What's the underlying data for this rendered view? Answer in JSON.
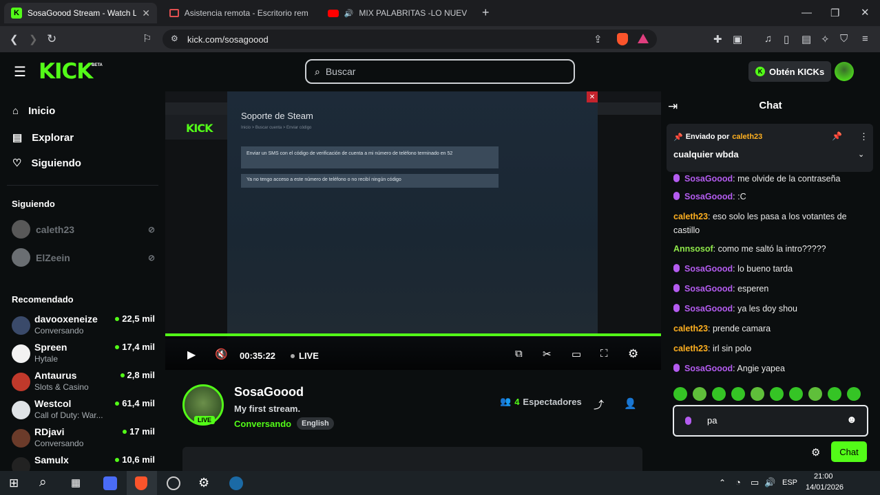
{
  "browser": {
    "tabs": [
      {
        "title": "SosaGoood Stream - Watch Live"
      },
      {
        "title": "Asistencia remota - Escritorio remoto"
      },
      {
        "title": "MIX PALABRITAS -LO NUEVO DE"
      }
    ],
    "new_tab": "+",
    "url": "kick.com/sosagoood",
    "shield_count": "5"
  },
  "header": {
    "logo": "KICK",
    "logo_beta": "BETA",
    "search_placeholder": "Buscar",
    "get_kicks": "Obtén KICKs"
  },
  "sidebar": {
    "nav": [
      {
        "label": "Inicio"
      },
      {
        "label": "Explorar"
      },
      {
        "label": "Siguiendo"
      }
    ],
    "following_title": "Siguiendo",
    "following": [
      {
        "name": "caleth23"
      },
      {
        "name": "ElZeein"
      }
    ],
    "recommended_title": "Recomendado",
    "recommended": [
      {
        "name": "davooxeneize",
        "category": "Conversando",
        "viewers": "22,5 mil"
      },
      {
        "name": "Spreen",
        "category": "Hytale",
        "viewers": "17,4 mil"
      },
      {
        "name": "Antaurus",
        "category": "Slots & Casino",
        "viewers": "2,8 mil"
      },
      {
        "name": "Westcol",
        "category": "Call of Duty: War...",
        "viewers": "61,4 mil"
      },
      {
        "name": "RDjavi",
        "category": "Conversando",
        "viewers": "17 mil"
      },
      {
        "name": "Samulx",
        "category": "",
        "viewers": "10,6 mil"
      }
    ]
  },
  "player": {
    "inner_dialog_title": "Soporte de Steam",
    "inner_breadcrumb": "Inicio > Buscar cuenta > Enviar código",
    "inner_option1": "Enviar un SMS con el código de verificación de cuenta a mi número de teléfono terminado en 52",
    "inner_option2": "Ya no tengo acceso a este número de teléfono o no recibí ningún código",
    "time": "00:35:22",
    "live": "LIVE",
    "progress": 1.0
  },
  "stream": {
    "channel": "SosaGoood",
    "live_badge": "LIVE",
    "title": "My first stream.",
    "category": "Conversando",
    "language": "English",
    "viewers_count": "4",
    "viewers_label": "Espectadores"
  },
  "chat": {
    "title": "Chat",
    "pinned_by_label": "Enviado por",
    "pinned_user": "caleth23",
    "pinned_message": "cualquier wbda",
    "messages": [
      {
        "user": "SosaGoood",
        "text": ": me olvide de la contraseña",
        "color": "#b45cf0",
        "mic": true
      },
      {
        "user": "SosaGoood",
        "text": ": :C",
        "color": "#b45cf0",
        "mic": true
      },
      {
        "user": "caleth23",
        "text": ": eso solo les pasa a los votantes de castillo",
        "color": "#ffb020",
        "mic": false
      },
      {
        "user": "Annsosof",
        "text": ": como me saltó la intro?????",
        "color": "#8fe84a",
        "mic": false
      },
      {
        "user": "SosaGoood",
        "text": ": lo bueno tarda",
        "color": "#b45cf0",
        "mic": true
      },
      {
        "user": "SosaGoood",
        "text": ": esperen",
        "color": "#b45cf0",
        "mic": true
      },
      {
        "user": "SosaGoood",
        "text": ": ya les doy shou",
        "color": "#b45cf0",
        "mic": true
      },
      {
        "user": "caleth23",
        "text": ": prende camara",
        "color": "#ffb020",
        "mic": false
      },
      {
        "user": "caleth23",
        "text": ": irl sin polo",
        "color": "#ffb020",
        "mic": false
      },
      {
        "user": "SosaGoood",
        "text": ": Angie yapea",
        "color": "#b45cf0",
        "mic": true
      }
    ],
    "input_value": "pa",
    "send_label": "Chat"
  },
  "taskbar": {
    "lang": "ESP",
    "time": "21:00",
    "date": "14/01/2026"
  },
  "colors": {
    "accent": "#53fc18",
    "background": "#0b0e0f"
  }
}
